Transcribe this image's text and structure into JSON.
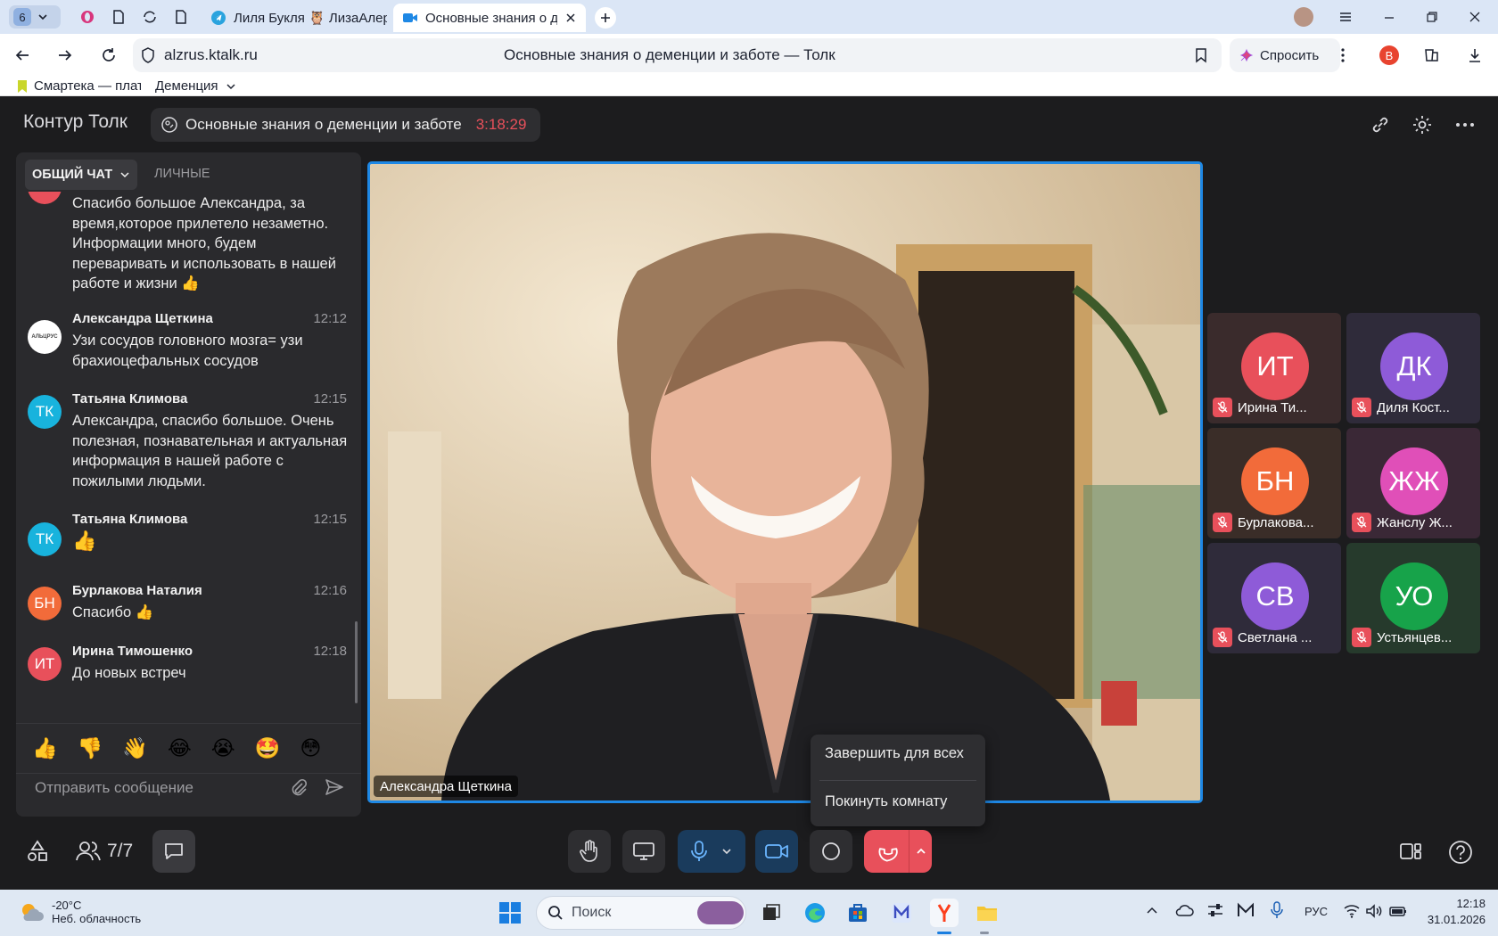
{
  "browser": {
    "tab_count": "6",
    "tabs": [
      {
        "label": "Лиля Букля 🦉 ЛизаАлер"
      },
      {
        "label": "Основные знания о деменции и заботе — Толк"
      }
    ],
    "url": "alzrus.ktalk.ru",
    "page_title": "Основные знания о деменции и заботе — Толк",
    "ask_label": "Спросить",
    "profile_letter": "В",
    "bookmarks": [
      {
        "label": "Смартека — плат"
      },
      {
        "label": "Деменция"
      }
    ]
  },
  "app": {
    "brand": "Контур Толк",
    "meeting_title": "Основные знания о деменции и заботе",
    "timer": "3:18:29",
    "accent": "#1e88e5",
    "timer_color": "#e8505b"
  },
  "chat": {
    "tab_general": "ОБЩИЙ ЧАТ",
    "tab_private": "ЛИЧНЫЕ",
    "messages": [
      {
        "initials": "ИТ",
        "avatar_color": "#e8505b",
        "name": "",
        "time": "",
        "text": "Спасибо большое Александра, за время,которое прилетело незаметно. Информации много, будем переваривать и использовать в нашей работе и жизни 👍"
      },
      {
        "initials": "АЛЬЦРУС",
        "avatar_color": "#ffffff",
        "name": "Александра Щеткина",
        "time": "12:12",
        "text": "Узи сосудов головного мозга= узи брахиоцефальных сосудов"
      },
      {
        "initials": "ТК",
        "avatar_color": "#18b3dd",
        "name": "Татьяна Климова",
        "time": "12:15",
        "text": "Александра, спасибо большое. Очень полезная, познавательная и актуальная информация в нашей работе с пожилыми людьми."
      },
      {
        "initials": "ТК",
        "avatar_color": "#18b3dd",
        "name": "Татьяна Климова",
        "time": "12:15",
        "text": "👍"
      },
      {
        "initials": "БН",
        "avatar_color": "#f26b3a",
        "name": "Бурлакова Наталия",
        "time": "12:16",
        "text": "Спасибо 👍"
      },
      {
        "initials": "ИТ",
        "avatar_color": "#e8505b",
        "name": "Ирина Тимошенко",
        "time": "12:18",
        "text": "До новых встреч"
      }
    ],
    "reactions": [
      "👍",
      "👎",
      "👋",
      "😂",
      "😭",
      "🤩",
      "😳"
    ],
    "input_placeholder": "Отправить сообщение"
  },
  "main_video": {
    "speaker_name": "Александра Щеткина"
  },
  "participants": [
    {
      "initials": "ИТ",
      "color": "#e8505b",
      "tile_bg": "#3a2b2c",
      "label": "Ирина Ти..."
    },
    {
      "initials": "ДК",
      "color": "#8e5bd8",
      "tile_bg": "#2f2b3a",
      "label": "Диля Кост..."
    },
    {
      "initials": "БН",
      "color": "#f26b3a",
      "tile_bg": "#3a2d28",
      "label": "Бурлакова..."
    },
    {
      "initials": "ЖЖ",
      "color": "#e04fb8",
      "tile_bg": "#3a2836",
      "label": "Жанслу Ж..."
    },
    {
      "initials": "СВ",
      "color": "#8e5bd8",
      "tile_bg": "#2f2b3a",
      "label": "Светлана ..."
    },
    {
      "initials": "УО",
      "color": "#17a34a",
      "tile_bg": "#263a2c",
      "label": "Устьянцев..."
    }
  ],
  "end_menu": {
    "end_for_all": "Завершить для всех",
    "leave_room": "Покинуть комнату"
  },
  "toolbar": {
    "participants_count": "7/7"
  },
  "taskbar": {
    "temperature": "-20°C",
    "weather": "Неб. облачность",
    "search_placeholder": "Поиск",
    "language": "РУС",
    "time": "12:18",
    "date": "31.01.2026"
  }
}
